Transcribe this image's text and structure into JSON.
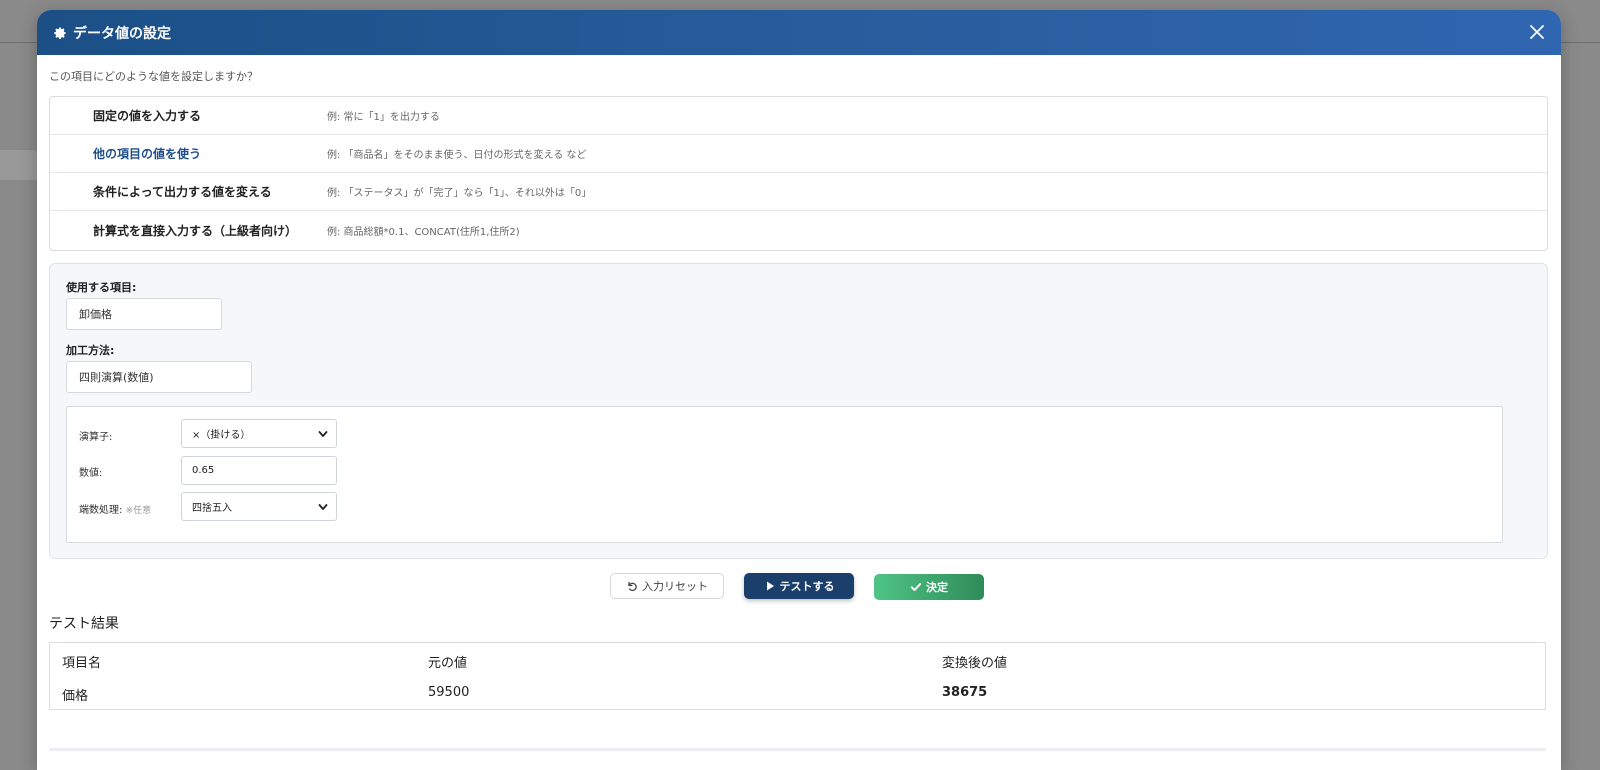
{
  "dialog": {
    "title": "データ値の設定",
    "prompt": "この項目にどのような値を設定しますか？"
  },
  "options": [
    {
      "label": "固定の値を入力する",
      "example": "例: 常に「1」を出力する",
      "active": false
    },
    {
      "label": "他の項目の値を使う",
      "example": "例: 「商品名」をそのまま使う、日付の形式を変える など",
      "active": true
    },
    {
      "label": "条件によって出力する値を変える",
      "example": "例: 「ステータス」が「完了」なら「1」、それ以外は「0」",
      "active": false
    },
    {
      "label": "計算式を直接入力する（上級者向け）",
      "example": "例: 商品総額*0.1、CONCAT(住所1,住所2)",
      "active": false
    }
  ],
  "config": {
    "field_label": "使用する項目:",
    "field_value": "卸価格",
    "method_label": "加工方法:",
    "method_value": "四則演算(数値)",
    "operator_label": "演算子:",
    "operator_value": "×（掛ける）",
    "number_label": "数値:",
    "number_value": "0.65",
    "rounding_label": "端数処理:",
    "rounding_note": "※任意",
    "rounding_value": "四捨五入"
  },
  "buttons": {
    "reset": "入力リセット",
    "test": "テストする",
    "ok": "決定"
  },
  "result": {
    "title": "テスト結果",
    "headers": [
      "項目名",
      "元の値",
      "変換後の値"
    ],
    "rows": [
      [
        "価格",
        "59500",
        "38675"
      ]
    ]
  },
  "colors": {
    "header_gradient_start": "#1b4f86",
    "header_gradient_end": "#2f66b0",
    "active_option": "#1f4f8a",
    "test_button": "#1a3f6a",
    "ok_button_start": "#4fc486",
    "ok_button_end": "#2f8c58"
  }
}
